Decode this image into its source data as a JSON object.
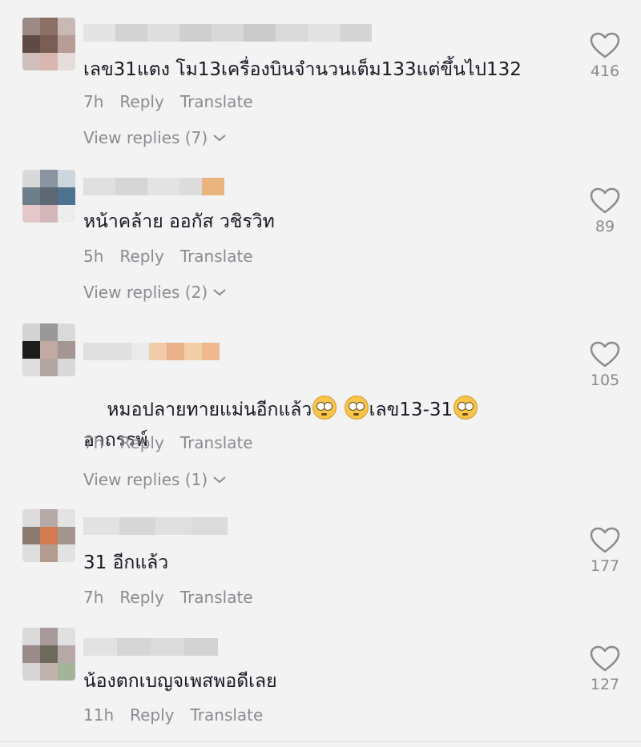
{
  "comments": [
    {
      "text": "เลข31แตง โม13เครื่องบินจำนวนเต็ม133แต่ขึ้นไป132",
      "time": "7h",
      "reply_label": "Reply",
      "translate_label": "Translate",
      "view_replies": "View replies (7)",
      "likes": "416"
    },
    {
      "text": "หน้าคล้าย ออกัส วชิรวิท",
      "time": "5h",
      "reply_label": "Reply",
      "translate_label": "Translate",
      "view_replies": "View replies (2)",
      "likes": "89"
    },
    {
      "text_line1": "หมอปลายทายแม่นอีกแล้ว",
      "text_part2": "เลข13-31",
      "text_line2": "อาถรรพ์",
      "time": "7h",
      "reply_label": "Reply",
      "translate_label": "Translate",
      "view_replies": "View replies (1)",
      "likes": "105"
    },
    {
      "text": "31 อีกแล้ว",
      "time": "7h",
      "reply_label": "Reply",
      "translate_label": "Translate",
      "likes": "177"
    },
    {
      "text": "น้องตกเบญจเพสพอดีเลย",
      "time": "11h",
      "reply_label": "Reply",
      "translate_label": "Translate",
      "likes": "127"
    }
  ],
  "icons": {
    "like": "heart-outline-icon",
    "expand": "chevron-down-icon",
    "emoji": "flushed-face-emoji"
  },
  "colors": {
    "background": "#f3f3f3",
    "text": "#161823",
    "secondary": "#8a8b91"
  }
}
